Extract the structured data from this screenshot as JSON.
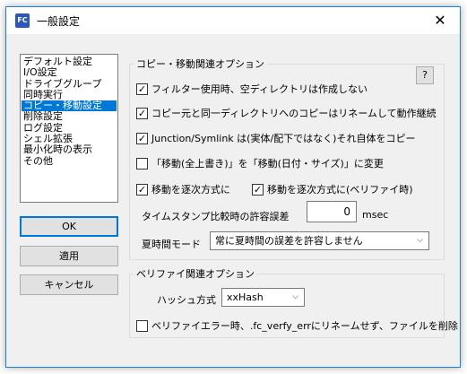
{
  "window": {
    "title": "一般設定",
    "app_icon_text": "FC",
    "close_glyph": "✕"
  },
  "sidebar": {
    "items": [
      {
        "label": "デフォルト設定",
        "selected": false
      },
      {
        "label": "I/O設定",
        "selected": false
      },
      {
        "label": "ドライブグループ",
        "selected": false
      },
      {
        "label": "同時実行",
        "selected": false
      },
      {
        "label": "コピー・移動設定",
        "selected": true
      },
      {
        "label": "削除設定",
        "selected": false
      },
      {
        "label": "ログ設定",
        "selected": false
      },
      {
        "label": "シェル拡張",
        "selected": false
      },
      {
        "label": "最小化時の表示",
        "selected": false
      },
      {
        "label": "その他",
        "selected": false
      }
    ]
  },
  "buttons": {
    "ok": "OK",
    "apply": "適用",
    "cancel": "キャンセル",
    "help": "?"
  },
  "copy_group": {
    "title": "コピー・移動関連オプション",
    "opt1": {
      "label": "フィルター使用時、空ディレクトリは作成しない",
      "checked": true
    },
    "opt2": {
      "label": "コピー元と同一ディレクトリへのコピーはリネームして動作継続",
      "checked": true
    },
    "opt3": {
      "label": "Junction/Symlink は(実体/配下ではなく)それ自体をコピー",
      "checked": true
    },
    "opt4": {
      "label": "「移動(全上書き)」を「移動(日付・サイズ)」に変更",
      "checked": false
    },
    "opt5": {
      "label": "移動を逐次方式に",
      "checked": true
    },
    "opt6": {
      "label": "移動を逐次方式に(ベリファイ時)",
      "checked": true
    },
    "timestamp_label": "タイムスタンプ比較時の許容誤差",
    "timestamp_value": "0",
    "timestamp_unit": "msec",
    "dst_label": "夏時間モード",
    "dst_value": "常に夏時間の誤差を許容しません"
  },
  "verify_group": {
    "title": "ベリファイ関連オプション",
    "hash_label": "ハッシュ方式",
    "hash_value": "xxHash",
    "opt_verify_err": {
      "label": "ベリファイエラー時、.fc_verfy_errにリネームせず、ファイルを削除",
      "checked": false
    }
  },
  "colors": {
    "accent": "#0078d7",
    "window_bg": "#f0f0f0"
  }
}
